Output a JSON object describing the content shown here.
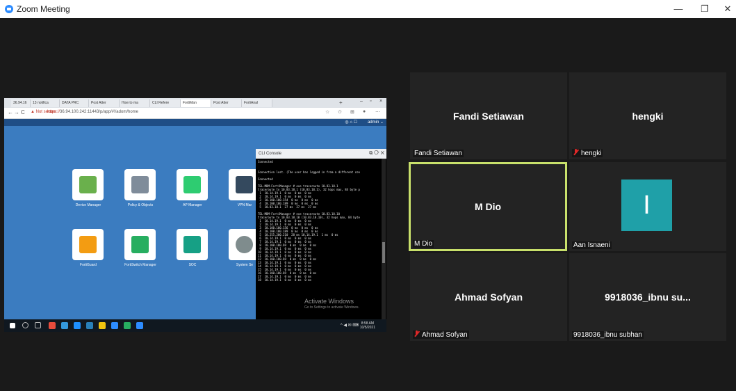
{
  "window": {
    "title": "Zoom Meeting",
    "minimize": "—",
    "restore": "❐",
    "close": "✕"
  },
  "share": {
    "tabs": [
      "36.94.16",
      "13 notifica",
      "DATA PRC",
      "Post Atter",
      "How to ma",
      "CLI Refere",
      "FortiMan",
      "Post Atter",
      "FortiAnal"
    ],
    "address": {
      "warning": "▲ Not secure",
      "url_scheme": "https://",
      "url_rest": "36.94.100.242:11443/p/app/#!/adom/home"
    },
    "header": {
      "icons": "◎ ⌂ ☐",
      "admin": "admin ⌄"
    },
    "tiles": [
      {
        "label": "Device Manager",
        "color": "#6ab04c"
      },
      {
        "label": "Policy & Objects",
        "color": "#7f8c9a"
      },
      {
        "label": "AP Manager",
        "color": "#2ecc71"
      },
      {
        "label": "VPN Mar",
        "color": "#34495e"
      },
      {
        "label": "FortiGuard",
        "color": "#f39c12"
      },
      {
        "label": "FortiSwitch Manager",
        "color": "#27ae60"
      },
      {
        "label": "SOC",
        "color": "#16a085"
      },
      {
        "label": "System Se",
        "color": "#7f8c8d"
      }
    ],
    "cli": {
      "title": "CLI Console",
      "controls": "⧉ ⟳ ✕",
      "lines": [
        "Connected",
        "",
        "",
        "Connection lost. (The user has logged in from a different con",
        "",
        "Connected",
        "",
        "TEL-MBM-FortiManager # exe traceroute 10.83.18.1",
        "traceroute to 10.83.18.1 (10.83.18.1), 32 hops max, 84 byte p",
        " 1  10.14.19.1  0 ms  0 ms  0 ms",
        " 2  10.14.19.1  0 ms  0 ms  0 ms",
        " 3  10.100.100.154  0 ms  0 ms  0 ms",
        " 4  10.100.100.189  0 ms  0 ms  0 ms",
        " 5  10.83.18.1  27 ms  27 ms  27 ms",
        "",
        "TEL-MBM-FortiManager # exe traceroute 10.83.18.10",
        "traceroute to 10.83.18.10 (10.83.18.10), 32 hops max, 84 byte",
        " 1  10.14.19.1  0 ms  0 ms  0 ms",
        " 2  10.14.19.1  0 ms  0 ms  0 ms",
        " 3  10.100.100.156  0 ms  0 ms  0 ms",
        " 4  10.100.100.189  0 ms  0 ms  0 ms",
        " 5  10.255.200.210  28 ms 10.14.19.1  1 ms  0 ms",
        " 6  10.14.19.1  0 ms  0 ms  0 ms",
        " 7  10.14.19.1  0 ms  0 ms  0 ms",
        " 8  10.100.100.69  0 ms  0 ms  0 ms",
        " 9  10.14.19.1  0 ms  0 ms  0 ms",
        "10  10.14.19.1  0 ms  0 ms  0 ms",
        "11  10.14.19.1  0 ms  0 ms  0 ms",
        "12  10.100.100.69  0 ms  0 ms  0 ms",
        "13  10.14.19.1  0 ms  0 ms  0 ms",
        "14  10.14.19.1  0 ms  0 ms  0 ms",
        "15  10.14.19.1  0 ms  0 ms  0 ms",
        "16  10.100.100.69  0 ms  0 ms  0 ms",
        "17  10.14.19.1  0 ms  0 ms  0 ms",
        "18  10.14.19.1  0 ms  0 ms  0 ms"
      ]
    },
    "watermark": {
      "title": "Activate Windows",
      "subtitle": "Go to Settings to activate Windows."
    },
    "taskbar": {
      "tray": "^ ◀ ✉ ⌨",
      "time": "8:58 AM",
      "date": "10/5/2021"
    }
  },
  "participants": [
    {
      "display": "Fandi Setiawan",
      "label": "Fandi Setiawan",
      "muted": false,
      "speaking": false
    },
    {
      "display": "hengki",
      "label": "hengki",
      "muted": true,
      "speaking": false
    },
    {
      "display": "M Dio",
      "label": "M Dio",
      "muted": false,
      "speaking": true
    },
    {
      "display": "I",
      "label": "Aan Isnaeni",
      "muted": false,
      "speaking": false,
      "avatar": true
    },
    {
      "display": "Ahmad Sofyan",
      "label": "Ahmad Sofyan",
      "muted": true,
      "speaking": false
    },
    {
      "display": "9918036_ibnu su...",
      "label": "9918036_ibnu subhan",
      "muted": false,
      "speaking": false
    }
  ]
}
